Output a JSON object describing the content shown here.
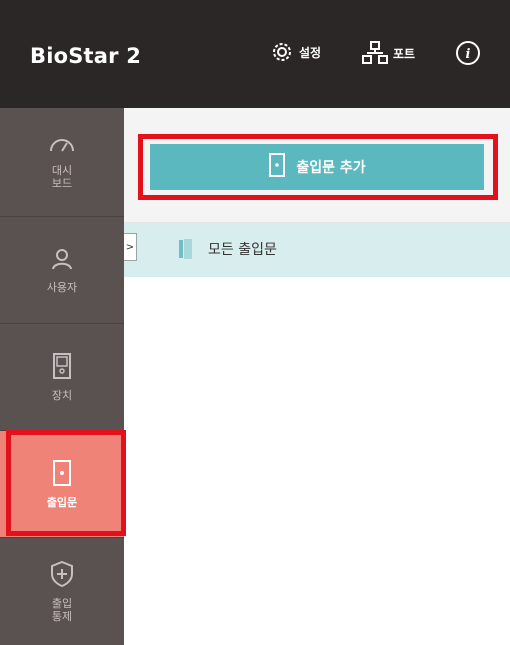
{
  "header": {
    "brand": "BioStar 2",
    "settings_label": "설정",
    "port_label": "포트",
    "info_icon": "info-icon"
  },
  "sidebar": {
    "items": [
      {
        "lines": [
          "대시",
          "보드"
        ],
        "icon": "gauge-icon"
      },
      {
        "lines": [
          "사용자"
        ],
        "icon": "user-icon"
      },
      {
        "lines": [
          "장치"
        ],
        "icon": "device-icon"
      },
      {
        "lines": [
          "출입문"
        ],
        "icon": "door-icon",
        "active": true
      },
      {
        "lines": [
          "출입",
          "통제"
        ],
        "icon": "shield-plus-icon"
      }
    ]
  },
  "main": {
    "add_door_button": "출입문 추가",
    "tree": {
      "toggle": ">",
      "root_label": "모든 출입문"
    }
  },
  "colors": {
    "header_bg": "#2b2727",
    "sidebar_bg": "#5a5151",
    "active_bg": "#f08377",
    "button_bg": "#5bb8bf",
    "tree_row_bg": "#d8edee",
    "highlight": "#e3111b"
  }
}
